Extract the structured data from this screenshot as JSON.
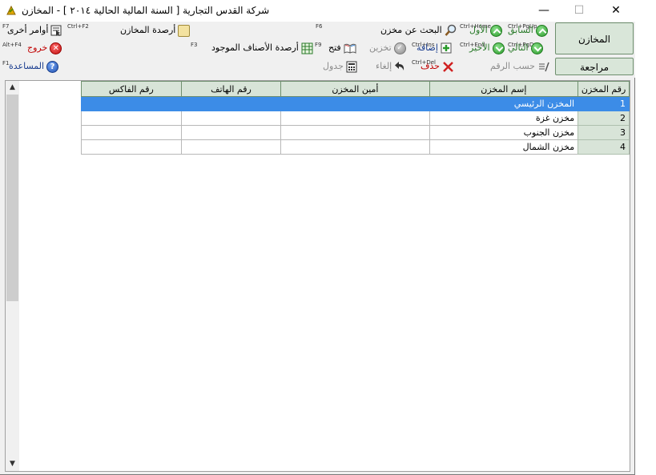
{
  "window": {
    "title": "شركة القدس التجارية  [ السنة المالية الحالية ٢٠١٤ ] - المخازن",
    "minimize": "—",
    "maximize": "☐",
    "close": "✕"
  },
  "toolbar": {
    "row1": {
      "previous": {
        "label": "السابق",
        "shortcut": "Ctrl+PgUp"
      },
      "first": {
        "label": "الأول",
        "shortcut": "Ctrl+Home"
      },
      "search": {
        "label": "البحث عن مخزن",
        "shortcut": "F6"
      },
      "balances": {
        "label": "أرصدة المخازن",
        "shortcut": "Ctrl+F2"
      },
      "other": {
        "label": "أوامر أخرى",
        "shortcut": "F7"
      }
    },
    "row2": {
      "next": {
        "label": "التالي",
        "shortcut": "Ctrl+PgDn"
      },
      "last": {
        "label": "الأخير",
        "shortcut": "Ctrl+End"
      },
      "add": {
        "label": "إضافة",
        "shortcut": "Ctrl+Ins"
      },
      "save": {
        "label": "تخزين",
        "shortcut": ""
      },
      "open": {
        "label": "فتح",
        "shortcut": "F9"
      },
      "item_balances": {
        "label": "أرصدة الأصناف الموجود",
        "shortcut": "F3"
      },
      "exit": {
        "label": "خروج",
        "shortcut": "Alt+F4"
      }
    },
    "row3": {
      "by_number": {
        "label": "حسب الرقم"
      },
      "delete": {
        "label": "حذف",
        "shortcut": "Ctrl+Del"
      },
      "cancel": {
        "label": "إلغاء"
      },
      "table": {
        "label": "جدول"
      },
      "help": {
        "label": "المساعدة",
        "shortcut": "F1"
      }
    },
    "side": {
      "stores": "المخازن",
      "review": "مراجعة"
    }
  },
  "grid": {
    "columns": [
      "رقم المخزن",
      "إسم المخزن",
      "أمين المخزن",
      "رقم الهاتف",
      "رقم الفاكس"
    ],
    "rows": [
      {
        "num": "1",
        "name": "المخزن الرئيسي",
        "keeper": "",
        "phone": "",
        "fax": "",
        "selected": true
      },
      {
        "num": "2",
        "name": "مخزن غزة",
        "keeper": "",
        "phone": "",
        "fax": "",
        "selected": false
      },
      {
        "num": "3",
        "name": "مخزن الجنوب",
        "keeper": "",
        "phone": "",
        "fax": "",
        "selected": false
      },
      {
        "num": "4",
        "name": "مخزن الشمال",
        "keeper": "",
        "phone": "",
        "fax": "",
        "selected": false
      }
    ]
  },
  "colors": {
    "header_green": "#d8e4d8",
    "selection_blue": "#3c8ce7",
    "exit_red": "#c00000",
    "help_blue": "#1b3e8f"
  }
}
